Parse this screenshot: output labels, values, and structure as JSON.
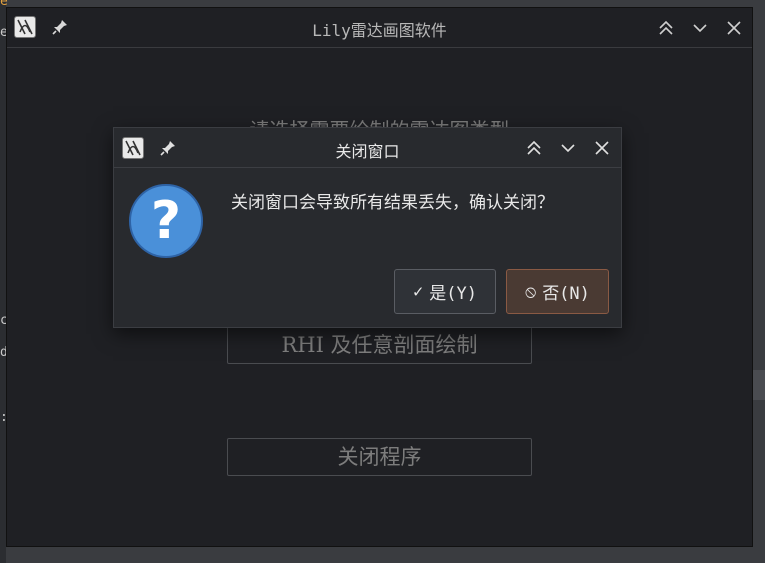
{
  "main_window": {
    "title": "Lily雷达画图软件",
    "prompt": "请选择需要绘制的雷达图类型",
    "buttons": {
      "rhi_label": "RHI 及任意剖面绘制",
      "close_label": "关闭程序"
    }
  },
  "background_edge": {
    "chars": [
      "e",
      "e",
      "c",
      "d",
      ":"
    ]
  },
  "dialog": {
    "title": "关闭窗口",
    "message": "关闭窗口会导致所有结果丢失，确认关闭？",
    "icon_glyph": "?",
    "yes_label": "是(Y)",
    "yes_glyph": "✓",
    "no_label": "否(N)",
    "no_glyph": "⦸"
  },
  "colors": {
    "window_bg": "#1f2024",
    "dialog_bg": "#282a2e",
    "question_blue": "#4a90d9",
    "no_button_bg": "#4a3a33",
    "no_button_border": "#8a5a44"
  },
  "icons": [
    "app-icon",
    "pin-icon",
    "collapse-icon",
    "minimize-icon",
    "close-icon",
    "question-icon",
    "check-icon",
    "forbidden-icon"
  ]
}
